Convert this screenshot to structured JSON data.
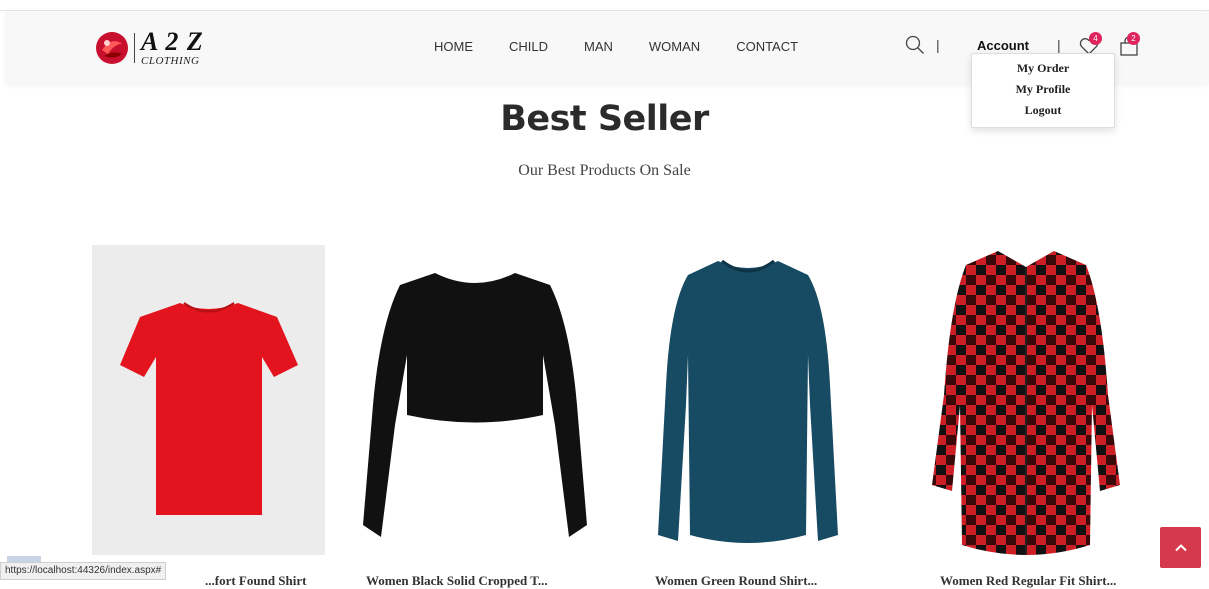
{
  "brand": {
    "title": "A 2 Z",
    "subtitle": "CLOTHING"
  },
  "nav": {
    "items": [
      {
        "label": "HOME"
      },
      {
        "label": "CHILD"
      },
      {
        "label": "MAN"
      },
      {
        "label": "WOMAN"
      },
      {
        "label": "CONTACT"
      }
    ]
  },
  "header": {
    "divider": "|",
    "account_label": "Account",
    "wishlist_count": "4",
    "cart_count": "2"
  },
  "account_menu": {
    "items": [
      {
        "label": "My Order"
      },
      {
        "label": "My Profile"
      },
      {
        "label": "Logout"
      }
    ]
  },
  "section": {
    "title": "Best Seller",
    "subtitle": "Our Best Products On Sale"
  },
  "products": [
    {
      "name": "...fort Found Shirt",
      "color": "#e3141d"
    },
    {
      "name": "Women Black Solid Cropped T...",
      "color": "#111111"
    },
    {
      "name": "Women Green Round Shirt...",
      "color": "#174a63"
    },
    {
      "name": "Women Red Regular Fit Shirt...",
      "color": "#cc1f25"
    }
  ],
  "status_url": "https://localhost:44326/index.aspx#",
  "colors": {
    "accent": "#d6394b",
    "badge": "#e0245e"
  },
  "icons": {
    "search": "search-icon",
    "wishlist": "heart-icon",
    "cart": "shopping-bag-icon",
    "back_to_top": "chevron-up-icon"
  }
}
